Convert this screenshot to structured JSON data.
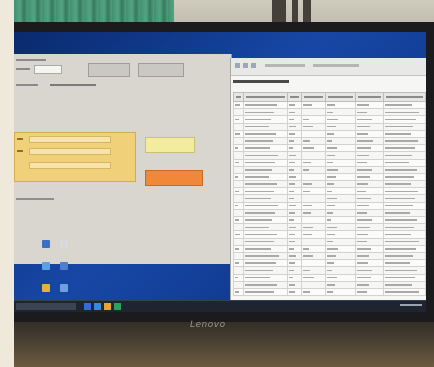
{
  "photo": {
    "monitor_brand": "Lenovo"
  },
  "colors": {
    "desktop_blue": "#1747a6",
    "form_panel_yellow": "#f1d07a",
    "button_yellow": "#f3ec9e",
    "button_orange": "#f0883a",
    "taskbar": "#1e2530"
  }
}
